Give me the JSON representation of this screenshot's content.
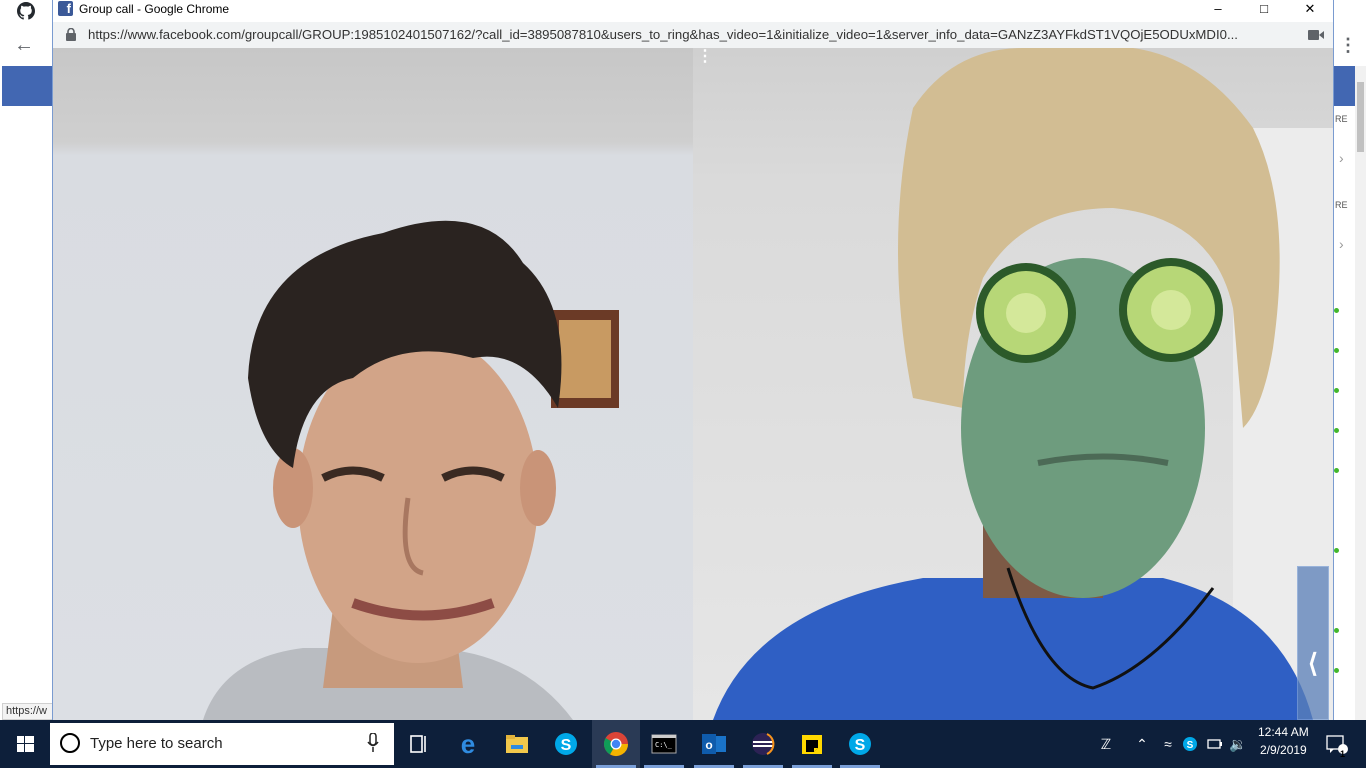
{
  "background_window": {
    "status_text": "https://w",
    "side_labels": [
      "RE",
      "RE"
    ]
  },
  "popup": {
    "window_title": "Group call - Google Chrome",
    "favicon_letter": "f",
    "url": "https://www.facebook.com/groupcall/GROUP:1985102401507162/?call_id=3895087810&users_to_ring&has_video=1&initialize_video=1&server_info_data=GANzZ3AYFkdST1VQOjE5ODUxMDI0...",
    "minimize_glyph": "–",
    "maximize_glyph": "□",
    "close_glyph": "✕",
    "more_glyph": "⋮",
    "collapse_glyph": "⟨"
  },
  "taskbar": {
    "search_placeholder": "Type here to search",
    "time": "12:44 AM",
    "date": "2/9/2019",
    "notification_count": "1",
    "apps": [
      "task-view",
      "edge",
      "file-explorer",
      "skype",
      "chrome",
      "command-prompt",
      "outlook",
      "eclipse",
      "sticky-notes",
      "skype"
    ],
    "colors": {
      "taskbar_bg": "#0d1f3a",
      "facebook_blue": "#4267b2"
    }
  }
}
